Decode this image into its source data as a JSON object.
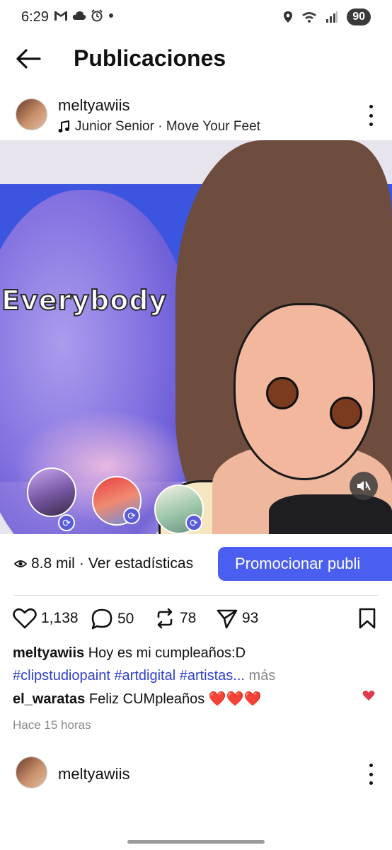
{
  "status_bar": {
    "time": "6:29",
    "battery": "90",
    "left_icons": [
      "gmail-icon",
      "cloud-icon",
      "alarm-icon",
      "dot-icon"
    ],
    "right_icons": [
      "location-icon",
      "wifi-icon",
      "signal-icon"
    ]
  },
  "header": {
    "title": "Publicaciones"
  },
  "post": {
    "username": "meltyawiis",
    "music": "Junior Senior · Move Your Feet",
    "media_text": "Everybody",
    "views": "8.8 mil",
    "separator": "·",
    "stats_link": "Ver estadísticas",
    "promote_label": "Promocionar publi",
    "likes": "1,138",
    "comments": "50",
    "reposts": "78",
    "shares": "93",
    "caption_user": "meltyawiis",
    "caption_text": "Hoy es mi cumpleaños:D",
    "caption_hashtags": "#clipstudiopaint #artdigital #artistas...",
    "caption_more": "más",
    "comment_user": "el_waratas",
    "comment_text": "Feliz CUMpleaños",
    "comment_hearts": "❤️❤️❤️",
    "time_ago": "Hace 15 horas"
  },
  "next_post": {
    "username": "meltyawiis"
  },
  "colors": {
    "accent": "#4a5ef0",
    "hashtag": "#2f3fc8",
    "muted_text": "#888888",
    "like_red": "#e03a4e"
  }
}
